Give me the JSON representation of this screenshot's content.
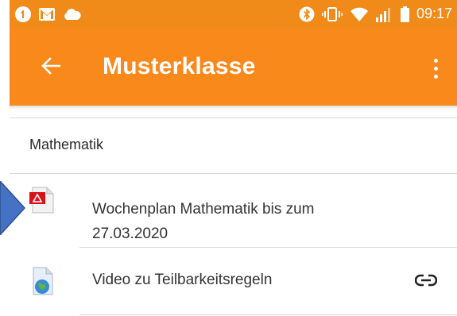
{
  "status_bar": {
    "time": "09:17",
    "left_icons": [
      "app-circle-icon",
      "gmail-icon",
      "cloud-icon"
    ],
    "right_icons": [
      "bluetooth-icon",
      "vibrate-icon",
      "wifi-icon",
      "signal-icon",
      "battery-icon"
    ]
  },
  "app_bar": {
    "title": "Musterklasse",
    "accent_color": "#f8891a"
  },
  "section": {
    "title": "Mathematik"
  },
  "items": [
    {
      "icon": "pdf-file-icon",
      "title": "Wochenplan Mathematik bis zum 27.03.2020",
      "line1": "Wochenplan Mathematik bis zum",
      "line2": "27.03.2020"
    },
    {
      "icon": "web-link-file-icon",
      "title": "Video zu Teilbarkeitsregeln",
      "action_icon": "link-icon"
    }
  ],
  "annotation_arrow_color": "#4472c4"
}
